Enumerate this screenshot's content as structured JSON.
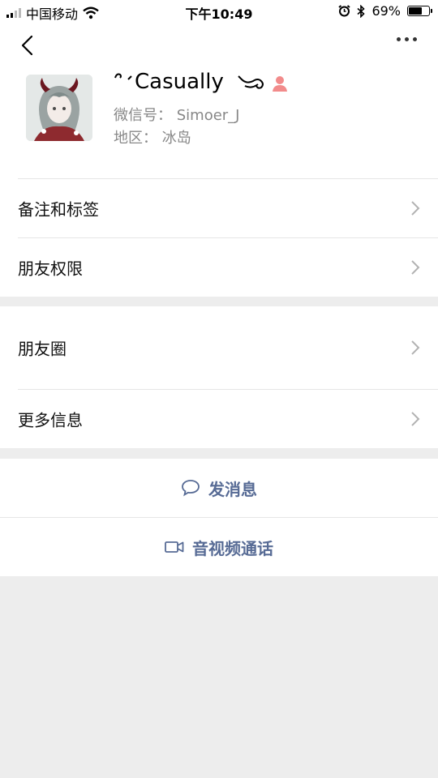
{
  "status_bar": {
    "carrier": "中国移动",
    "time": "下午10:49",
    "battery_percent": "69%",
    "battery_level": 0.69
  },
  "header": {
    "back_icon": "chevron-left-icon",
    "more_icon": "ellipsis-icon"
  },
  "profile": {
    "name": "Casually",
    "wechat_id_label": "微信号：",
    "wechat_id": "Simoer_J",
    "region_label": "地区：",
    "region": "冰岛",
    "gender_color": "#f28b8b"
  },
  "menu_group_1": {
    "items": [
      {
        "label": "备注和标签"
      },
      {
        "label": "朋友权限"
      }
    ]
  },
  "menu_group_2": {
    "items": [
      {
        "label": "朋友圈"
      },
      {
        "label": "更多信息"
      }
    ]
  },
  "actions": {
    "message_label": "发消息",
    "call_label": "音视频通话",
    "link_color": "#576b95"
  }
}
